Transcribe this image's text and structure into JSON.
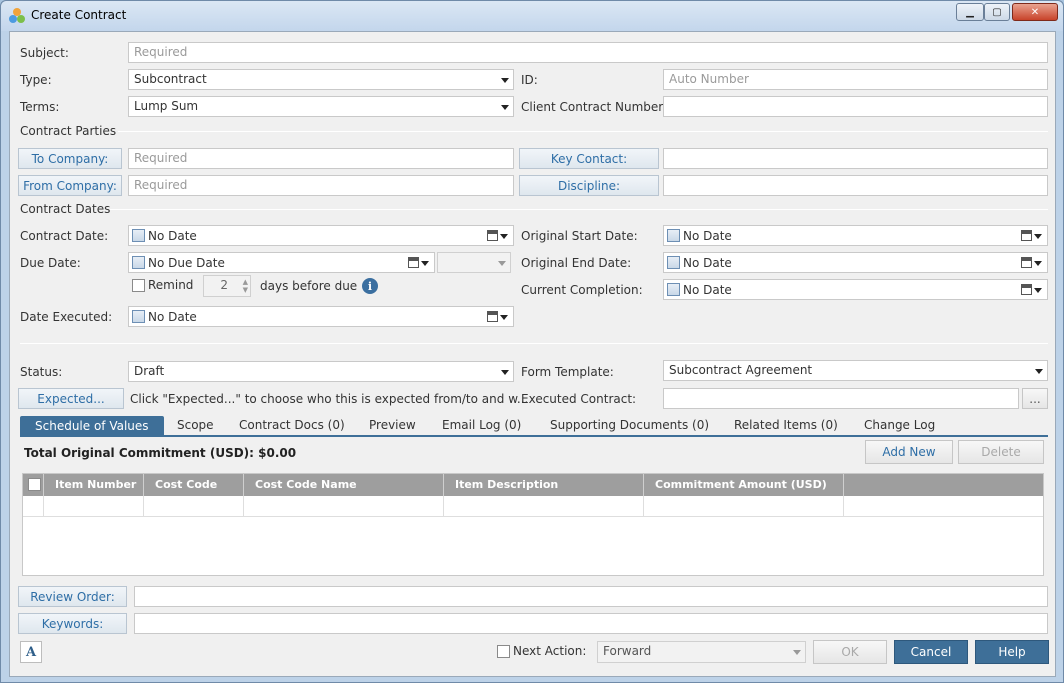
{
  "window": {
    "title": "Create Contract",
    "minimize": "▁",
    "maximize": "▢",
    "close": "✕"
  },
  "form": {
    "subject": {
      "label": "Subject:",
      "placeholder": "Required"
    },
    "type": {
      "label": "Type:",
      "value": "Subcontract"
    },
    "id": {
      "label": "ID:",
      "placeholder": "Auto Number"
    },
    "terms": {
      "label": "Terms:",
      "value": "Lump Sum"
    },
    "client_contract_number": {
      "label": "Client Contract Number:",
      "value": ""
    },
    "contract_parties_title": "Contract Parties",
    "to_company": {
      "label": "To Company:",
      "placeholder": "Required"
    },
    "key_contact": {
      "label": "Key Contact:",
      "value": ""
    },
    "from_company": {
      "label": "From Company:",
      "placeholder": "Required"
    },
    "discipline": {
      "label": "Discipline:",
      "value": ""
    },
    "contract_dates_title": "Contract Dates",
    "contract_date": {
      "label": "Contract Date:",
      "value": "No Date"
    },
    "due_date": {
      "label": "Due Date:",
      "value": "No Due Date"
    },
    "remind": {
      "label": "Remind",
      "days": "2",
      "suffix": "days before due"
    },
    "date_executed": {
      "label": "Date Executed:",
      "value": "No Date"
    },
    "original_start_date": {
      "label": "Original Start Date:",
      "value": "No Date"
    },
    "original_end_date": {
      "label": "Original End Date:",
      "value": "No Date"
    },
    "current_completion": {
      "label": "Current Completion:",
      "value": "No Date"
    },
    "status": {
      "label": "Status:",
      "value": "Draft"
    },
    "form_template": {
      "label": "Form Template:",
      "value": "Subcontract Agreement"
    },
    "expected": {
      "button": "Expected...",
      "hint": "Click \"Expected...\" to choose who this is expected from/to and w..."
    },
    "executed_contract": {
      "label": "Executed Contract:",
      "browse": "..."
    }
  },
  "tabs": [
    "Schedule of Values",
    "Scope",
    "Contract Docs (0)",
    "Preview",
    "Email Log (0)",
    "Supporting Documents (0)",
    "Related Items (0)",
    "Change Log"
  ],
  "sov": {
    "total_label": "Total Original Commitment (USD): $0.00",
    "add_new": "Add New",
    "delete": "Delete",
    "columns": [
      "Item Number",
      "Cost Code",
      "Cost Code Name",
      "Item Description",
      "Commitment Amount (USD)"
    ]
  },
  "footer": {
    "review_order": "Review Order:",
    "keywords": "Keywords:",
    "spell_check": "A",
    "next_action_label": "Next Action:",
    "next_action_value": "Forward",
    "ok": "OK",
    "cancel": "Cancel",
    "help": "Help"
  },
  "colors": {
    "accent": "#3e6f98",
    "link": "#2e6ea6",
    "window_frame": "#bdd2e8"
  }
}
